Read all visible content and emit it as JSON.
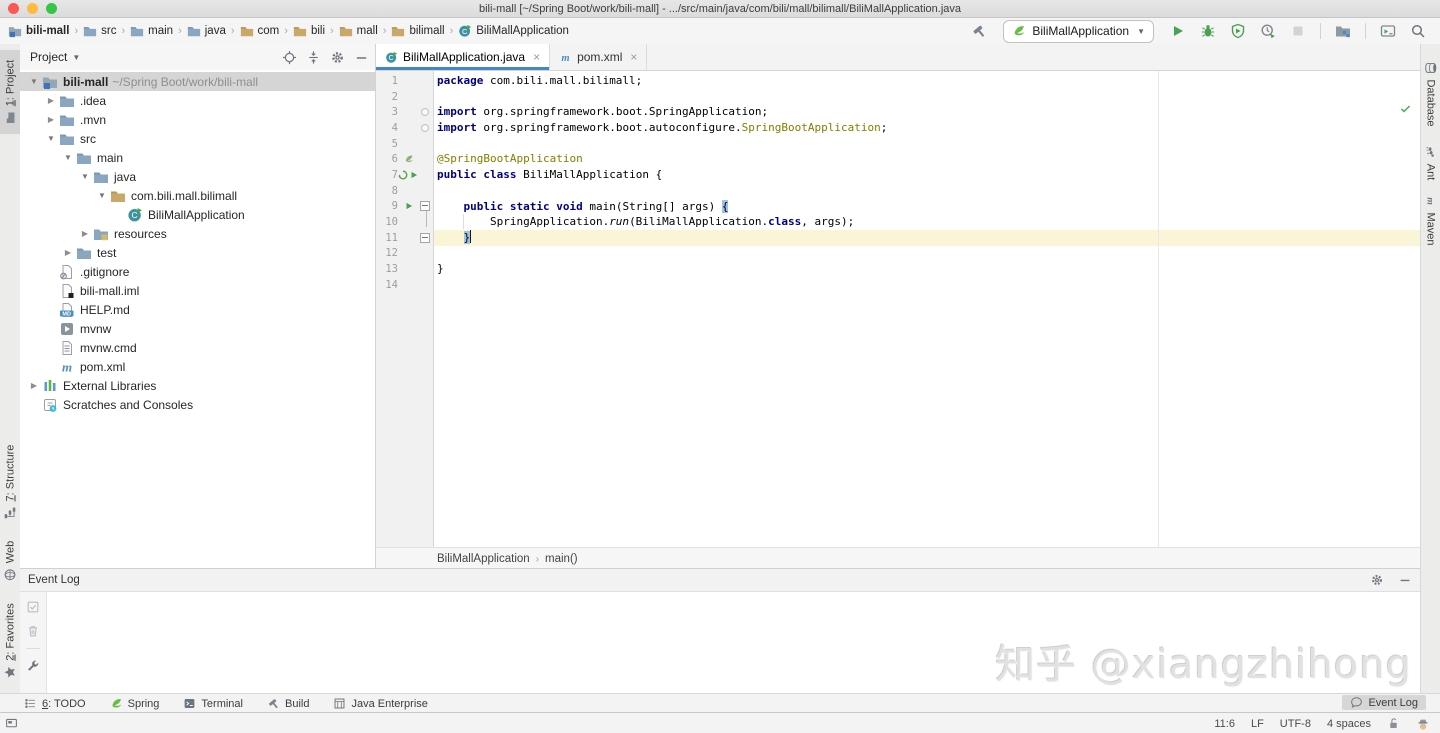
{
  "window": {
    "title": "bili-mall [~/Spring Boot/work/bili-mall] - .../src/main/java/com/bili/mall/bilimall/BiliMallApplication.java",
    "traffic_lights": {
      "close": "#fc5753",
      "minimize": "#fdbc40",
      "zoom": "#33c748"
    }
  },
  "toolbar": {
    "breadcrumbs": [
      {
        "label": "bili-mall",
        "icon": "folder-project",
        "bold": true
      },
      {
        "label": "src",
        "icon": "folder"
      },
      {
        "label": "main",
        "icon": "folder"
      },
      {
        "label": "java",
        "icon": "folder"
      },
      {
        "label": "com",
        "icon": "package"
      },
      {
        "label": "bili",
        "icon": "package"
      },
      {
        "label": "mall",
        "icon": "package"
      },
      {
        "label": "bilimall",
        "icon": "package"
      },
      {
        "label": "BiliMallApplication",
        "icon": "class"
      }
    ],
    "build_action": {
      "name": "build",
      "icon": "hammer"
    },
    "run_config": {
      "label": "BiliMallApplication",
      "icon": "spring"
    },
    "run_actions": [
      {
        "name": "run",
        "icon": "run"
      },
      {
        "name": "debug",
        "icon": "bug"
      },
      {
        "name": "run-with-coverage",
        "icon": "coverage"
      },
      {
        "name": "profiler",
        "icon": "profiler"
      },
      {
        "name": "stop",
        "icon": "stop",
        "disabled": true
      }
    ],
    "right_actions_a": [
      {
        "name": "project-structure",
        "icon": "structure-folder"
      }
    ],
    "right_actions_b": [
      {
        "name": "run-anything",
        "icon": "run-window"
      },
      {
        "name": "search-everywhere",
        "icon": "search"
      }
    ]
  },
  "left_stripe": [
    {
      "label": "1: Project",
      "icon": "project-tool",
      "mn": true,
      "active": true
    },
    {
      "label": "7: Structure",
      "icon": "structure-tool",
      "mn": true
    },
    {
      "label": "Web",
      "icon": "web-tool"
    },
    {
      "label": "2: Favorites",
      "icon": "favorites-tool",
      "mn": true
    }
  ],
  "right_stripe": [
    {
      "label": "Database",
      "icon": "database-tool"
    },
    {
      "label": "Ant",
      "icon": "ant-tool"
    },
    {
      "label": "Maven",
      "icon": "maven-tool"
    }
  ],
  "project_panel": {
    "title": "Project",
    "tree": [
      {
        "depth": 0,
        "arrow": "expanded",
        "icon": "folder-project",
        "label": "bili-mall",
        "suffix": "~/Spring Boot/work/bili-mall",
        "bold": true,
        "selected": true
      },
      {
        "depth": 1,
        "arrow": "collapsed",
        "icon": "folder",
        "label": ".idea"
      },
      {
        "depth": 1,
        "arrow": "collapsed",
        "icon": "folder",
        "label": ".mvn"
      },
      {
        "depth": 1,
        "arrow": "expanded",
        "icon": "folder",
        "label": "src"
      },
      {
        "depth": 2,
        "arrow": "expanded",
        "icon": "folder",
        "label": "main"
      },
      {
        "depth": 3,
        "arrow": "expanded",
        "icon": "folder",
        "label": "java"
      },
      {
        "depth": 4,
        "arrow": "expanded",
        "icon": "package",
        "label": "com.bili.mall.bilimall"
      },
      {
        "depth": 5,
        "arrow": "none",
        "icon": "class",
        "label": "BiliMallApplication"
      },
      {
        "depth": 3,
        "arrow": "collapsed",
        "icon": "folder-resources",
        "label": "resources"
      },
      {
        "depth": 2,
        "arrow": "collapsed",
        "icon": "folder",
        "label": "test"
      },
      {
        "depth": 1,
        "arrow": "none",
        "icon": "file-ignore",
        "label": ".gitignore"
      },
      {
        "depth": 1,
        "arrow": "none",
        "icon": "file-iml",
        "label": "bili-mall.iml"
      },
      {
        "depth": 1,
        "arrow": "none",
        "icon": "file-md",
        "label": "HELP.md"
      },
      {
        "depth": 1,
        "arrow": "none",
        "icon": "file-run",
        "label": "mvnw"
      },
      {
        "depth": 1,
        "arrow": "none",
        "icon": "file-text",
        "label": "mvnw.cmd"
      },
      {
        "depth": 1,
        "arrow": "none",
        "icon": "maven",
        "label": "pom.xml"
      },
      {
        "depth": 0,
        "arrow": "collapsed",
        "icon": "libraries",
        "label": "External Libraries"
      },
      {
        "depth": 0,
        "arrow": "none",
        "icon": "scratches",
        "label": "Scratches and Consoles"
      }
    ]
  },
  "editor": {
    "tabs": [
      {
        "label": "BiliMallApplication.java",
        "icon": "class",
        "active": true,
        "close": "×"
      },
      {
        "label": "pom.xml",
        "icon": "maven",
        "active": false,
        "close": "×"
      }
    ],
    "code_lines": [
      {
        "tokens": [
          [
            "k",
            "package"
          ],
          [
            "p",
            " com.bili.mall.bilimall;"
          ]
        ]
      },
      {
        "tokens": []
      },
      {
        "tokens": [
          [
            "k",
            "import"
          ],
          [
            "p",
            " org.springframework.boot.SpringApplication;"
          ]
        ],
        "fold": "dot"
      },
      {
        "tokens": [
          [
            "k",
            "import"
          ],
          [
            "p",
            " org.springframework.boot.autoconfigure."
          ],
          [
            "a",
            "SpringBootApplication"
          ],
          [
            "p",
            ";"
          ]
        ],
        "fold": "dot"
      },
      {
        "tokens": []
      },
      {
        "tokens": [
          [
            "a",
            "@SpringBootApplication"
          ]
        ],
        "gutter": [
          "spring-leaf-gutter"
        ]
      },
      {
        "tokens": [
          [
            "k",
            "public"
          ],
          [
            "p",
            " "
          ],
          [
            "k",
            "class"
          ],
          [
            "p",
            " BiliMallApplication {"
          ]
        ],
        "gutter": [
          "spring-bean",
          "run-small"
        ]
      },
      {
        "tokens": []
      },
      {
        "tokens": [
          [
            "p",
            "    "
          ],
          [
            "k",
            "public"
          ],
          [
            "p",
            " "
          ],
          [
            "k",
            "static"
          ],
          [
            "p",
            " "
          ],
          [
            "k",
            "void"
          ],
          [
            "p",
            " main(String[] args) "
          ],
          [
            "b",
            "{"
          ]
        ],
        "gutter": [
          "run-small"
        ],
        "fold": "box"
      },
      {
        "tokens": [
          [
            "p",
            "        SpringApplication."
          ],
          [
            "m",
            "run"
          ],
          [
            "p",
            "(BiliMallApplication."
          ],
          [
            "k",
            "class"
          ],
          [
            "p",
            ", args);"
          ]
        ]
      },
      {
        "tokens": [
          [
            "p",
            "    "
          ],
          [
            "b",
            "}"
          ]
        ],
        "fold": "box",
        "current": true,
        "caret": true
      },
      {
        "tokens": []
      },
      {
        "tokens": [
          [
            "p",
            "}"
          ]
        ]
      },
      {
        "tokens": []
      }
    ],
    "breadcrumbs": [
      "BiliMallApplication",
      "main()"
    ]
  },
  "event_log": {
    "title": "Event Log"
  },
  "bottom_bar": {
    "left": [
      {
        "label": "6: TODO",
        "icon": "todo-list",
        "mn": true
      },
      {
        "label": "Spring",
        "icon": "spring"
      },
      {
        "label": "Terminal",
        "icon": "terminal"
      },
      {
        "label": "Build",
        "icon": "hammer"
      },
      {
        "label": "Java Enterprise",
        "icon": "javaee"
      }
    ],
    "right": [
      {
        "label": "Event Log",
        "icon": "balloon",
        "active": true
      }
    ]
  },
  "status_bar": {
    "items": [
      "11:6",
      "LF",
      "UTF-8",
      "4 spaces"
    ]
  },
  "watermark": "知乎 @xiangzhihong",
  "colors": {
    "accent_blue": "#4285c8",
    "run_green": "#4aa152",
    "keyword": "#000080",
    "annotation": "#808000",
    "current_line": "#fbf5d7",
    "brace_match": "#a0c1e8",
    "selection_gray": "#d5d5d5"
  }
}
